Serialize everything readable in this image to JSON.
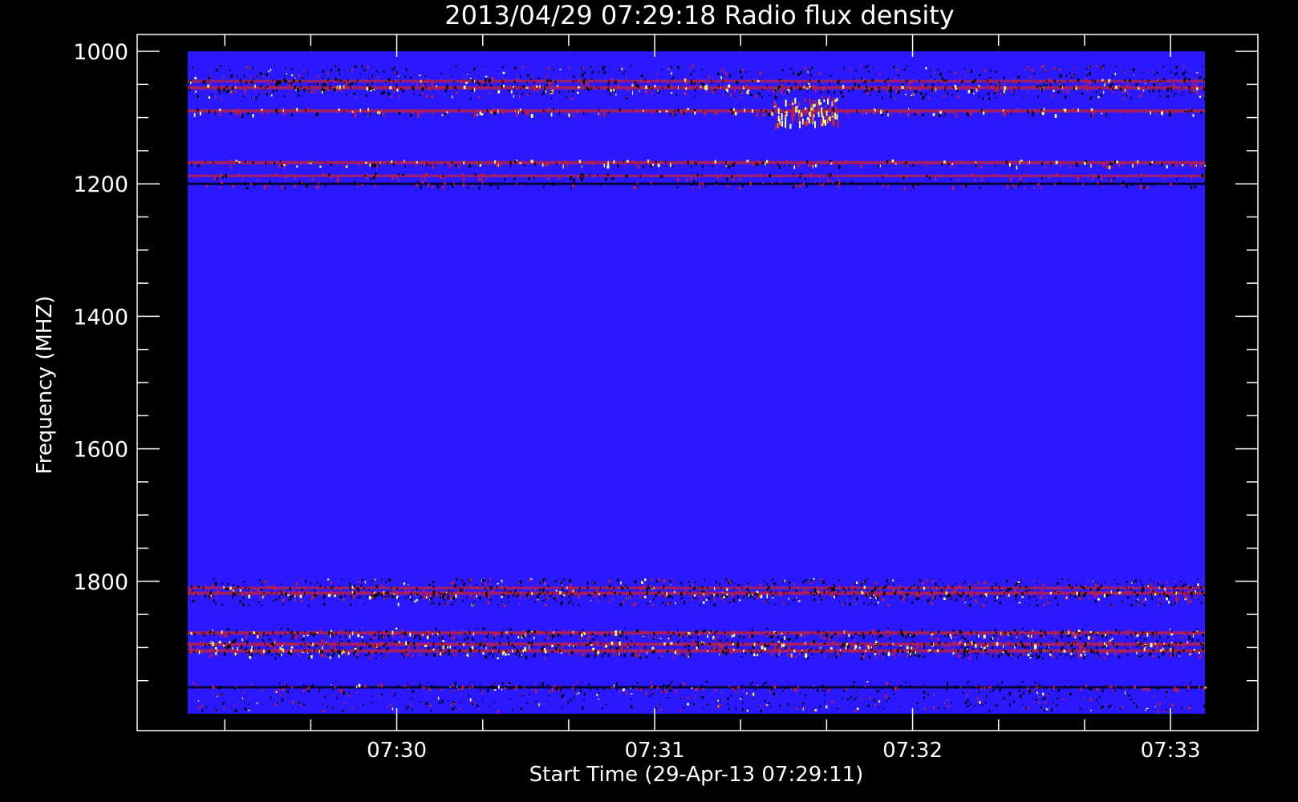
{
  "chart_data": {
    "type": "heatmap",
    "title": "2013/04/29 07:29:18 Radio flux density",
    "xlabel": "Start Time (29-Apr-13 07:29:11)",
    "ylabel": "Frequency (MHZ)",
    "x_tick_labels": [
      "07:30",
      "07:31",
      "07:32",
      "07:33"
    ],
    "y_tick_labels": [
      "1000",
      "1200",
      "1400",
      "1600",
      "1800"
    ],
    "y_ticks": [
      1000,
      1200,
      1400,
      1600,
      1800
    ],
    "ylim": [
      1000,
      2000
    ],
    "y_axis_inverted": true,
    "xlim": [
      "07:29:11",
      "07:33:11"
    ],
    "data_xlim": [
      "07:29:18",
      "07:33:11"
    ],
    "background_color": "#2a18ff",
    "colors": {
      "low": "#000000",
      "background": "#2a18ff",
      "mid": "#c02040",
      "high": "#ffff80"
    },
    "bands": [
      {
        "freq": 1045,
        "intensity": "medium"
      },
      {
        "freq": 1055,
        "intensity": "high"
      },
      {
        "freq": 1090,
        "intensity": "high"
      },
      {
        "freq": 1168,
        "intensity": "high"
      },
      {
        "freq": 1188,
        "intensity": "medium"
      },
      {
        "freq": 1200,
        "intensity": "low"
      },
      {
        "freq": 1810,
        "intensity": "medium"
      },
      {
        "freq": 1818,
        "intensity": "high"
      },
      {
        "freq": 1878,
        "intensity": "high"
      },
      {
        "freq": 1895,
        "intensity": "high"
      },
      {
        "freq": 1905,
        "intensity": "high"
      },
      {
        "freq": 1960,
        "intensity": "low"
      }
    ],
    "burst": {
      "time": "07:31:35",
      "freq_range": [
        1070,
        1110
      ]
    }
  }
}
